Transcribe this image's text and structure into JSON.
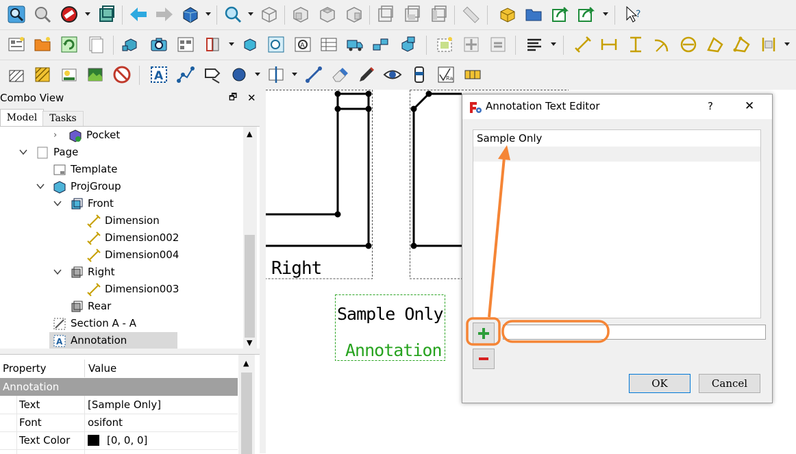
{
  "toolbar_icons": [
    "view-fit-icon",
    "zoom-icon",
    "no-entry-icon",
    "box-selection-icon",
    "back-arrow-icon",
    "forward-arrow-icon",
    "std-views-icon",
    "zoom-in-icon",
    "isometric-icon",
    "front-view-icon",
    "top-view-icon",
    "right-view-icon",
    "rear-view-icon",
    "bottom-view-icon",
    "left-view-icon",
    "measure-icon",
    "part-icon",
    "folder-icon",
    "link-icon",
    "link-sub-icon",
    "whats-this-icon"
  ],
  "combo": {
    "title": "Combo View",
    "tabs": [
      {
        "label": "Model"
      },
      {
        "label": "Tasks"
      }
    ],
    "tree": [
      {
        "label": "Pocket"
      },
      {
        "label": "Page"
      },
      {
        "label": "Template"
      },
      {
        "label": "ProjGroup"
      },
      {
        "label": "Front"
      },
      {
        "label": "Dimension"
      },
      {
        "label": "Dimension002"
      },
      {
        "label": "Dimension004"
      },
      {
        "label": "Right"
      },
      {
        "label": "Dimension003"
      },
      {
        "label": "Rear"
      },
      {
        "label": "Section A - A"
      },
      {
        "label": "Annotation"
      }
    ],
    "properties": {
      "col_property": "Property",
      "col_value": "Value",
      "group": "Annotation",
      "rows": [
        {
          "name": "Text",
          "value": "[Sample Only]"
        },
        {
          "name": "Font",
          "value": "osifont"
        },
        {
          "name": "Text Color",
          "value": "[0, 0, 0]"
        }
      ]
    }
  },
  "drawing": {
    "view_label": "Right",
    "annotation_line1": "Sample Only",
    "annotation_line2": "Annotation"
  },
  "dialog": {
    "title": "Annotation Text Editor",
    "help": "?",
    "close": "✕",
    "list_items": [
      "Sample Only"
    ],
    "new_text_value": "",
    "ok": "OK",
    "cancel": "Cancel"
  },
  "colors": {
    "highlight": "#f58536",
    "annotation_green": "#27a31f",
    "group_header": "#a0a0a0"
  }
}
